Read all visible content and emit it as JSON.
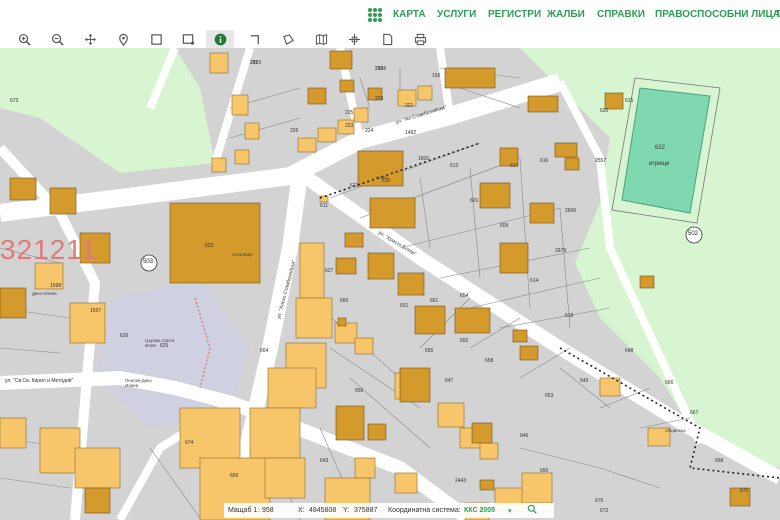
{
  "nav": {
    "items": [
      "КАРТА",
      "УСЛУГИ",
      "РЕГИСТРИ",
      "ЖАЛБИ",
      "СПРАВКИ",
      "ПРАВОСПОСОБНИ ЛИЦА",
      "Т"
    ]
  },
  "toolbar": {
    "tools": [
      "zoom-in-icon",
      "zoom-out-icon",
      "pan-icon",
      "marker-icon",
      "select-rect-icon",
      "select-rect-alt-icon",
      "info-icon",
      "measure-line-icon",
      "measure-area-icon",
      "map-icon",
      "crosshair-icon",
      "document-icon",
      "print-icon"
    ]
  },
  "map": {
    "colors": {
      "parcel": "#d3d3d3",
      "road": "#ffffff",
      "green": "#d6f5d0",
      "building": "#f7c66a",
      "building_dark": "#d49a2c",
      "stadium": "#7fd8b0",
      "boundary": "#ffd6d6"
    },
    "big_label": "321211",
    "stadium_labels": [
      "622",
      "игрище"
    ],
    "street_labels": [
      "ул. \"Ал.Стамболийски\"",
      "ул. \"Христо Ботев\"",
      "ул. \"Св.Св. Кирил и Методий\"",
      "ул. \"Алеко Стамболийски\""
    ],
    "circle_labels": [
      "502",
      "503"
    ],
    "parcel_numbers": [
      "227",
      "219",
      "156",
      "220",
      "221",
      "225",
      "223",
      "224",
      "226",
      "1482",
      "1600",
      "613",
      "617",
      "616",
      "2557",
      "620",
      "621",
      "610",
      "611",
      "601",
      "609",
      "614",
      "618",
      "615",
      "623",
      "625",
      "626",
      "627",
      "660",
      "661",
      "654",
      "651",
      "655",
      "656",
      "652",
      "658",
      "653",
      "649",
      "648",
      "647",
      "646",
      "650",
      "659",
      "643",
      "664",
      "666",
      "667",
      "668",
      "670",
      "672",
      "673",
      "674",
      "675",
      "2443",
      "2606",
      "2679",
      "1598",
      "1597",
      "2553",
      "2558"
    ],
    "text_labels": [
      "Пенсия Дико Илиев",
      "Църква Свети Илия",
      "Дико Илиев",
      "общинска",
      "читалище",
      "хотел"
    ]
  },
  "statusbar": {
    "scale_label": "Мащаб 1:",
    "scale_value": "958",
    "x_label": "X:",
    "x_value": "4845808",
    "y_label": "Y:",
    "y_value": "375887",
    "crs_label": "Координатна система:",
    "crs_value": "ККС 2005"
  }
}
